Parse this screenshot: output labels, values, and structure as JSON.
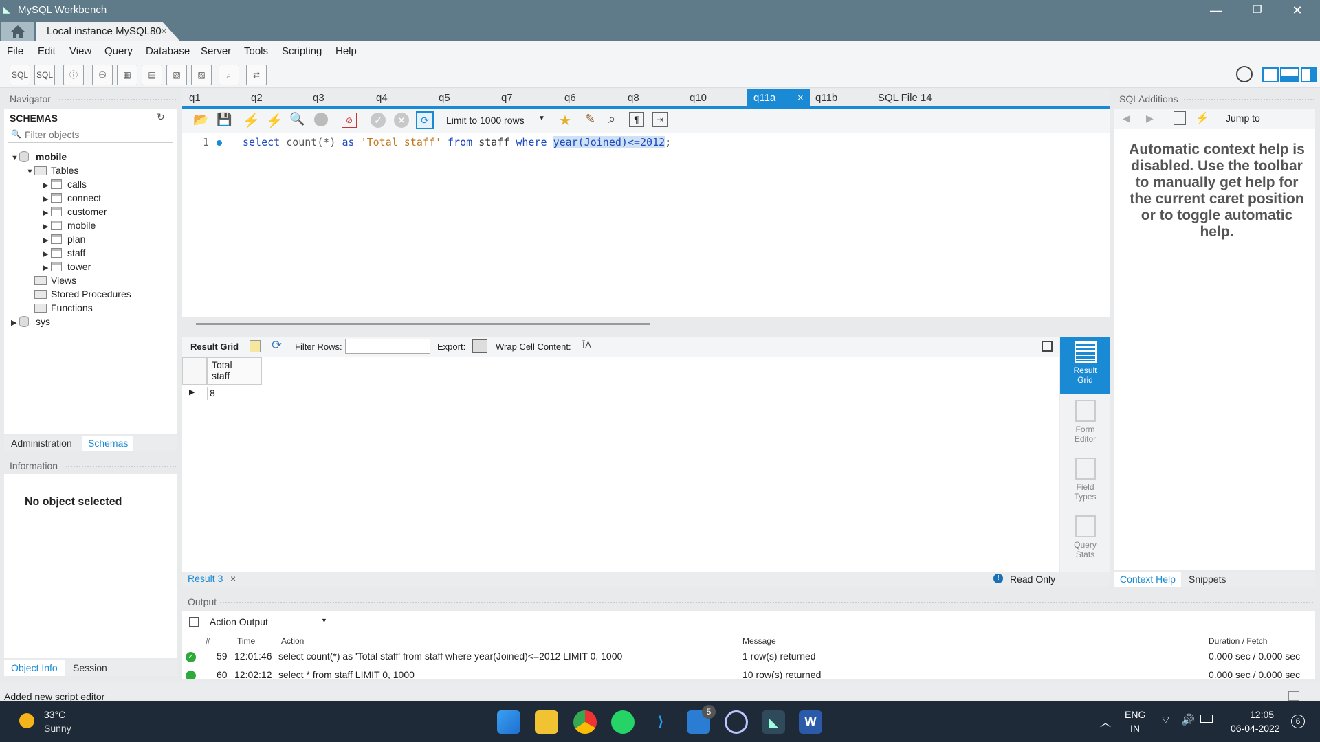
{
  "window": {
    "title": "MySQL Workbench",
    "minimize": "—",
    "restore": "❐",
    "close": "✕"
  },
  "connection_tab": {
    "label": "Local instance MySQL80",
    "close": "×"
  },
  "menu": [
    "File",
    "Edit",
    "View",
    "Query",
    "Database",
    "Server",
    "Tools",
    "Scripting",
    "Help"
  ],
  "navigator": {
    "title": "Navigator",
    "schemas_label": "SCHEMAS",
    "filter_placeholder": "Filter objects",
    "schema_mobile": "mobile",
    "tables_label": "Tables",
    "tables": [
      "calls",
      "connect",
      "customer",
      "mobile",
      "plan",
      "staff",
      "tower"
    ],
    "views_label": "Views",
    "procs_label": "Stored Procedures",
    "functions_label": "Functions",
    "schema_sys": "sys",
    "tab_admin": "Administration",
    "tab_schemas": "Schemas"
  },
  "info": {
    "title": "Information",
    "empty": "No object selected",
    "tab_object": "Object Info",
    "tab_session": "Session"
  },
  "editor_tabs": [
    "q1",
    "q2",
    "q3",
    "q4",
    "q5",
    "q7",
    "q6",
    "q8",
    "q10",
    "q11a",
    "q11b",
    "SQL File 14"
  ],
  "active_tab_close": "×",
  "editor_toolbar": {
    "limit": "Limit to 1000 rows"
  },
  "editor": {
    "line_number": "1",
    "kw_select": "select",
    "fn_count": "count(*)",
    "kw_as": "as",
    "str_alias": "'Total staff'",
    "kw_from": "from",
    "ident_table": "staff",
    "kw_where": "where",
    "selected_expr": "year(Joined)<=2012",
    "semicolon": ";"
  },
  "result_toolbar": {
    "result_grid": "Result Grid",
    "filter_rows": "Filter Rows:",
    "export": "Export:",
    "wrap": "Wrap Cell Content:"
  },
  "result_grid": {
    "column_l1": "Total",
    "column_l2": "staff",
    "value": "8"
  },
  "side_panel": {
    "result_grid_l1": "Result",
    "result_grid_l2": "Grid",
    "form_l1": "Form",
    "form_l2": "Editor",
    "field_l1": "Field",
    "field_l2": "Types",
    "query_l1": "Query",
    "query_l2": "Stats"
  },
  "result_tabs": {
    "tab": "Result 3",
    "close": "×",
    "read_only": "Read Only"
  },
  "sql_additions": {
    "title": "SQLAdditions",
    "jump_to": "Jump to",
    "help_text": "Automatic context help is disabled. Use the toolbar to manually get help for the current caret position or to toggle automatic help.",
    "tab_context": "Context Help",
    "tab_snippets": "Snippets"
  },
  "output": {
    "title": "Output",
    "selector": "Action Output",
    "headers": {
      "num": "#",
      "time": "Time",
      "action": "Action",
      "message": "Message",
      "duration": "Duration / Fetch"
    },
    "rows": [
      {
        "num": "59",
        "time": "12:01:46",
        "action": "select count(*) as 'Total staff' from staff where year(Joined)<=2012 LIMIT 0, 1000",
        "message": "1 row(s) returned",
        "duration": "0.000 sec / 0.000 sec"
      },
      {
        "num": "60",
        "time": "12:02:12",
        "action": "select * from staff LIMIT 0, 1000",
        "message": "10 row(s) returned",
        "duration": "0.000 sec / 0.000 sec"
      }
    ]
  },
  "status": {
    "text": "Added new script editor"
  },
  "taskbar": {
    "temp": "33°C",
    "weather": "Sunny",
    "lang1": "ENG",
    "lang2": "IN",
    "time": "12:05",
    "date": "06-04-2022",
    "notif_count": "6",
    "badge_5": "5"
  },
  "colors": {
    "accent": "#1a8ad4",
    "titlebar": "#5f7a88",
    "taskbar": "#1f2a38"
  }
}
